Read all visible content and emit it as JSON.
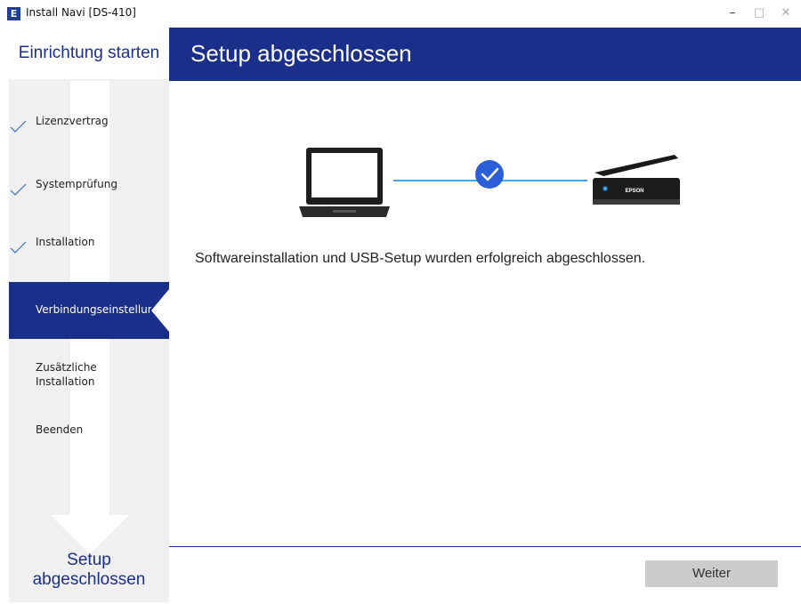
{
  "window": {
    "title": "Install Navi [DS-410]",
    "app_icon_letter": "E",
    "minimize_glyph": "–",
    "maximize_glyph": "□",
    "close_glyph": "✕"
  },
  "sidebar": {
    "header": "Einrichtung starten",
    "steps": [
      {
        "label": "Lizenzvertrag",
        "state": "done"
      },
      {
        "label": "Systemprüfung",
        "state": "done"
      },
      {
        "label": "Installation",
        "state": "done"
      },
      {
        "label": "Verbindungseinstellung",
        "state": "active"
      },
      {
        "label_line1": "Zusätzliche",
        "label_line2": "Installation",
        "state": "pending"
      },
      {
        "label": "Beenden",
        "state": "pending"
      }
    ],
    "footer_line1": "Setup",
    "footer_line2": "abgeschlossen"
  },
  "main": {
    "title": "Setup abgeschlossen",
    "message": "Softwareinstallation und USB-Setup wurden erfolgreich abgeschlossen.",
    "scanner_brand": "EPSON",
    "next_button": "Weiter"
  },
  "colors": {
    "brand_blue": "#1a2f8a",
    "check_blue": "#2b5fd9",
    "connector_line": "#4aa6d8"
  }
}
